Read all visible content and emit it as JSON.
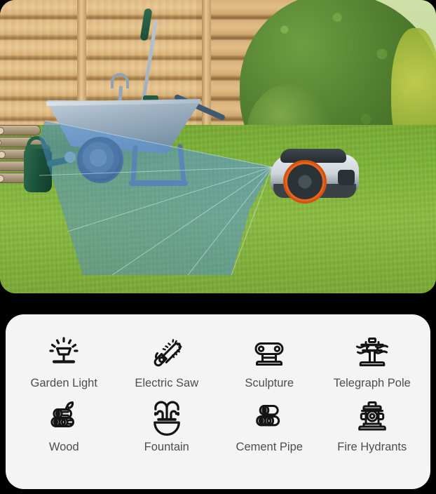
{
  "photo": {
    "name": "garden-scene-photo",
    "alt_description": "Robotic lawn mower on green lawn beside a metal wheelbarrow and watering can in front of a wooden slat fence, with a blue detection cone overlay",
    "scene_objects": [
      "wooden-slat-fence",
      "green-shrub-hedge",
      "grass-lawn",
      "log-pile",
      "green-watering-can",
      "metal-wheelbarrow",
      "garden-tool",
      "robot-lawn-mower",
      "blue-detection-cone"
    ],
    "overlay": {
      "name": "detection-cone",
      "color": "#3f7fd0",
      "opacity": 0.45
    },
    "colors": {
      "grass": "#7fb23a",
      "fence": "#e0bb85",
      "hedge": "#4f7c2e",
      "mower_body": "#cdd6dc",
      "mower_wheel": "#e8631c",
      "watering_can": "#1d4e38"
    }
  },
  "categories": {
    "name": "obstacle-category-list",
    "items": [
      {
        "icon": "garden-light-icon",
        "label": "Garden Light"
      },
      {
        "icon": "electric-saw-icon",
        "label": "Electric Saw"
      },
      {
        "icon": "sculpture-icon",
        "label": "Sculpture"
      },
      {
        "icon": "telegraph-pole-icon",
        "label": "Telegraph Pole"
      },
      {
        "icon": "wood-icon",
        "label": "Wood"
      },
      {
        "icon": "fountain-icon",
        "label": "Fountain"
      },
      {
        "icon": "cement-pipe-icon",
        "label": "Cement Pipe"
      },
      {
        "icon": "fire-hydrants-icon",
        "label": "Fire Hydrants"
      }
    ]
  },
  "theme": {
    "background": "#000000",
    "panel_background": "#f4f4f4",
    "label_color": "#4d4d4d",
    "icon_color": "#141414"
  }
}
